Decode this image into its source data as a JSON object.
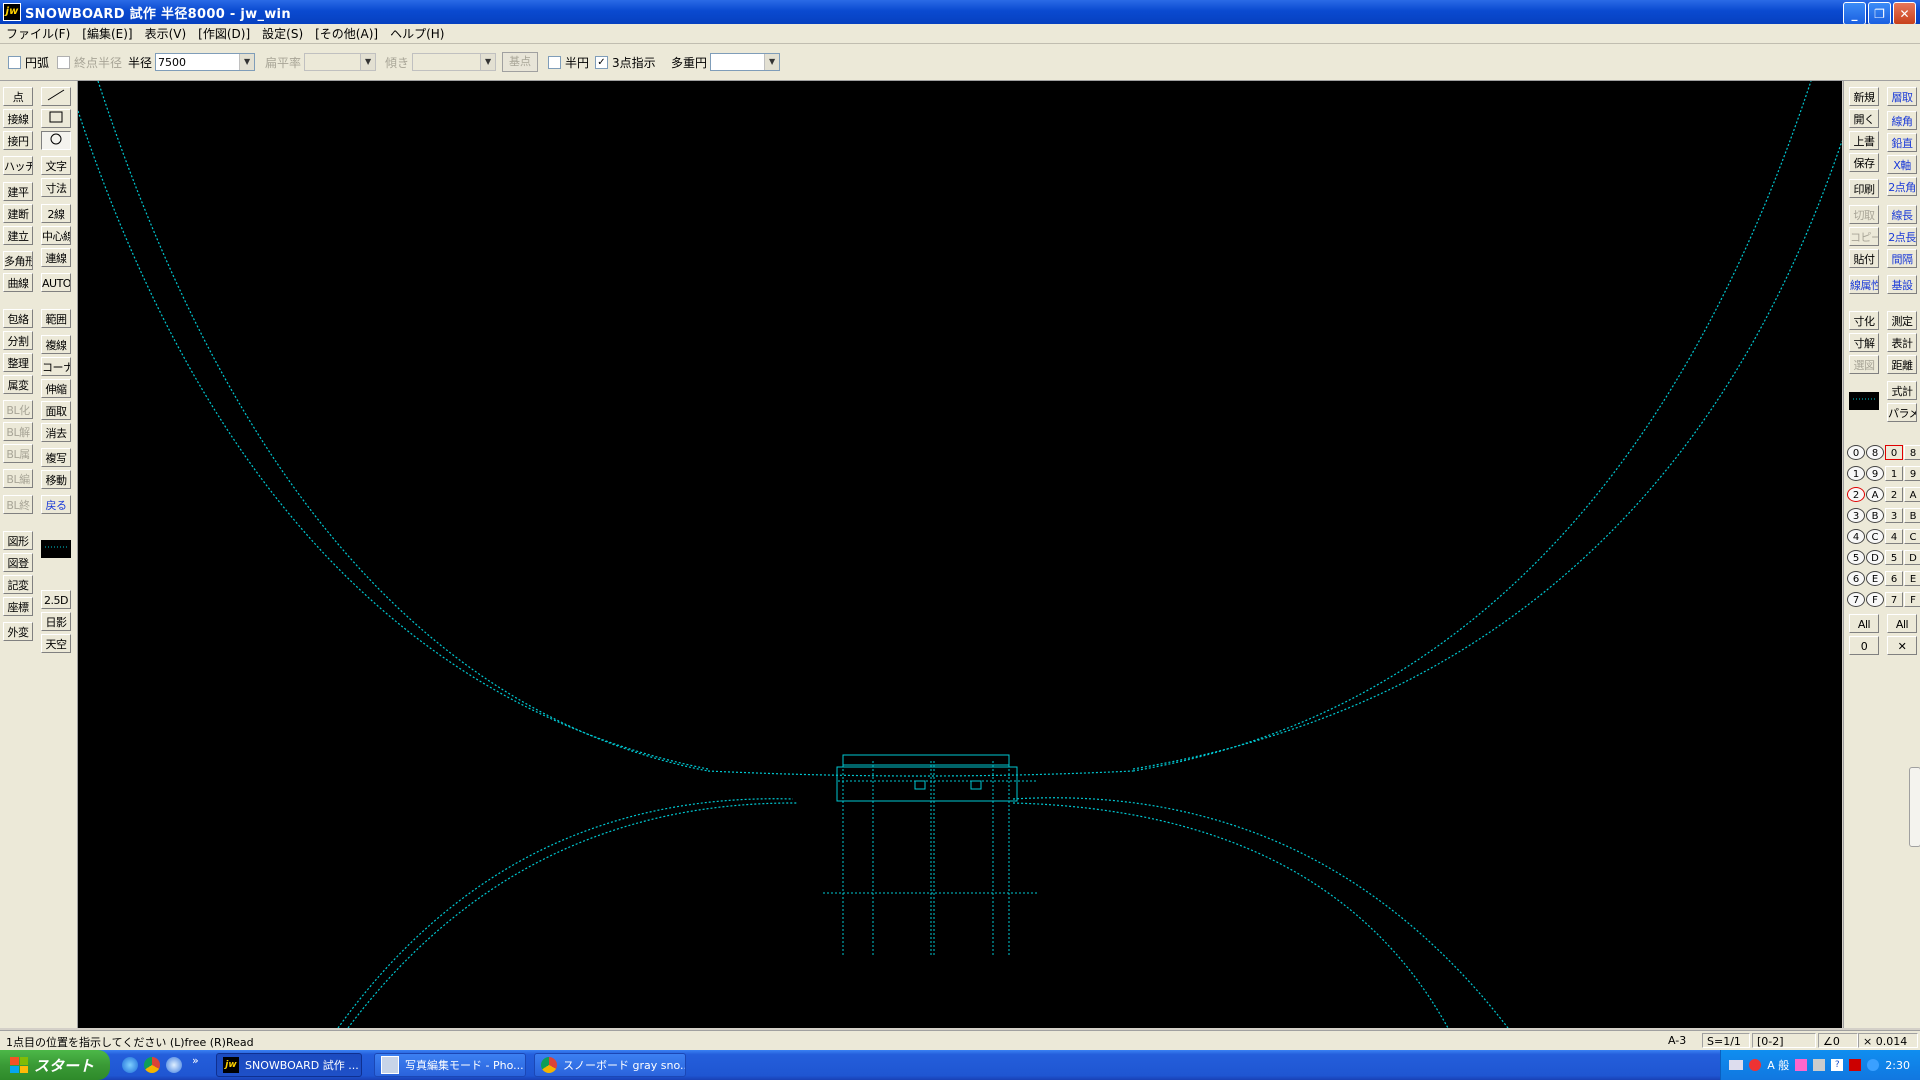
{
  "window": {
    "title": "SNOWBOARD 試作  半径8000 - jw_win",
    "app_icon": "jw"
  },
  "menu": [
    "ファイル(F)",
    "[編集(E)]",
    "表示(V)",
    "[作図(D)]",
    "設定(S)",
    "[その他(A)]",
    "ヘルプ(H)"
  ],
  "toolbar": {
    "arc_label": "円弧",
    "endpoint_radius_label": "終点半径",
    "radius_label": "半径",
    "radius_value": "7500",
    "flatness_label": "扁平率",
    "tilt_label": "傾き",
    "base_point_button": "基点",
    "half_circle_label": "半円",
    "three_point_label": "3点指示",
    "three_point_checked": "✓",
    "multi_circle_label": "多重円"
  },
  "left_tools": {
    "col1": [
      "点",
      "接線",
      "接円",
      "ハッチ",
      "建平",
      "建断",
      "建立",
      "多角形",
      "曲線",
      "包絡",
      "分割",
      "整理",
      "属変",
      "BL化",
      "BL解",
      "BL属",
      "BL編",
      "BL終",
      "図形",
      "図登",
      "記変",
      "座標",
      "外変"
    ],
    "col2_text": [
      "文字",
      "寸法",
      "2線",
      "中心線",
      "連線",
      "AUTO",
      "範囲",
      "複線",
      "コーナー",
      "伸縮",
      "面取",
      "消去",
      "複写",
      "移動",
      "戻る",
      "2.5D",
      "日影",
      "天空"
    ]
  },
  "right_tools": {
    "col1": [
      "新規",
      "開く",
      "上書",
      "保存",
      "印刷",
      "切取",
      "コピー",
      "貼付",
      "線属性",
      "寸化",
      "寸解",
      "選図"
    ],
    "col2": [
      "層取",
      "線角",
      "鉛直",
      "X軸",
      "2点角",
      "線長",
      "2点長",
      "間隔",
      "基設",
      "測定",
      "表計",
      "距離",
      "式計",
      "パラメ"
    ]
  },
  "layers": {
    "group_col1": [
      "0",
      "1",
      "2",
      "3",
      "4",
      "5",
      "6",
      "7"
    ],
    "group_col2": [
      "8",
      "9",
      "A",
      "B",
      "C",
      "D",
      "E",
      "F"
    ],
    "layer_col1": [
      "0",
      "1",
      "2",
      "3",
      "4",
      "5",
      "6",
      "7"
    ],
    "layer_col2": [
      "8",
      "9",
      "A",
      "B",
      "C",
      "D",
      "E",
      "F"
    ],
    "all_label": "All",
    "zero_label": "0",
    "x_label": "✕"
  },
  "status": {
    "message": "1点目の位置を指示してください (L)free  (R)Read",
    "paper": "A-3",
    "scale": "S=1/1",
    "layer": "[0-2]",
    "angle": "∠0",
    "zoom": "× 0.014"
  },
  "taskbar": {
    "start_label": "スタート",
    "items": [
      {
        "label": "SNOWBOARD 試作 ...",
        "icon": "jw"
      },
      {
        "label": "写真編集モード - Pho...",
        "icon": "photo-icon"
      },
      {
        "label": "スノーボード gray sno...",
        "icon": "chrome-icon"
      }
    ],
    "tray_ime": "A 般",
    "clock": "2:30"
  },
  "colors": {
    "canvas_bg": "#000000",
    "drawing_line": "#00c8d2",
    "titlebar": "#0a4ad0",
    "taskbar": "#245edb",
    "start_button": "#3a9a36"
  }
}
